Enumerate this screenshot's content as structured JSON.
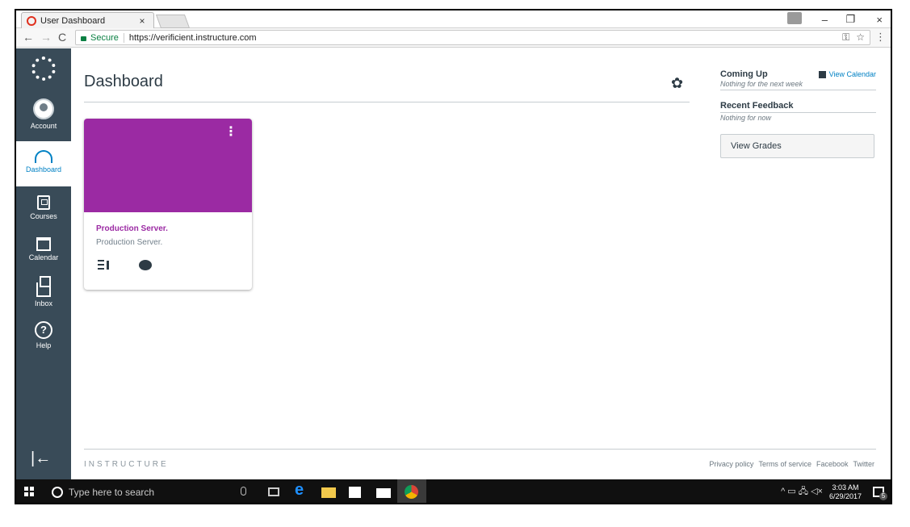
{
  "browser": {
    "tab_title": "User Dashboard",
    "tab_close": "×",
    "nav_back": "←",
    "nav_forward": "→",
    "nav_reload": "C",
    "secure_label": "Secure",
    "url": "https://verificient.instructure.com",
    "win_min": "–",
    "win_max": "❐",
    "win_close": "×",
    "omni_key_icon": "key-icon",
    "omni_star": "☆",
    "menu": "⋮"
  },
  "sidenav": {
    "items": [
      {
        "label": "Account",
        "icon": "account-icon"
      },
      {
        "label": "Dashboard",
        "icon": "dashboard-icon",
        "active": true
      },
      {
        "label": "Courses",
        "icon": "courses-icon"
      },
      {
        "label": "Calendar",
        "icon": "calendar-icon"
      },
      {
        "label": "Inbox",
        "icon": "inbox-icon"
      },
      {
        "label": "Help",
        "icon": "help-icon",
        "glyph": "?"
      }
    ],
    "collapse_glyph": "|←",
    "active_color": "#0081c4",
    "bg_color": "#394b58"
  },
  "main": {
    "title": "Dashboard",
    "gear_glyph": "✿"
  },
  "card": {
    "title": "Production Server.",
    "subtitle": "Production Server.",
    "menu_glyph": "⋮",
    "hero_color": "#9b2aa3"
  },
  "right": {
    "coming_up": "Coming Up",
    "view_calendar": "View Calendar",
    "coming_empty": "Nothing for the next week",
    "recent_feedback": "Recent Feedback",
    "feedback_empty": "Nothing for now",
    "view_grades": "View Grades"
  },
  "footer": {
    "logo": "INSTRUCTURE",
    "links": [
      "Privacy policy",
      "Terms of service",
      "Facebook",
      "Twitter"
    ]
  },
  "taskbar": {
    "search_placeholder": "Type here to search",
    "time": "3:03 AM",
    "date": "6/29/2017",
    "tray_glyphs": "^ ▭ 🖧 ◁×",
    "notif_count": "5"
  }
}
